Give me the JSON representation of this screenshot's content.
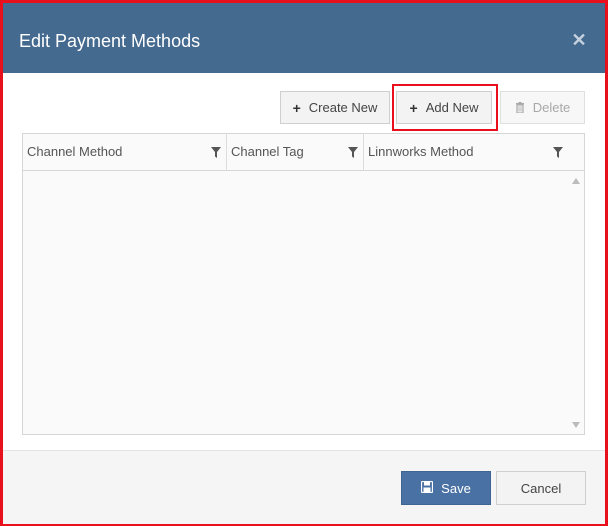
{
  "dialog": {
    "title": "Edit Payment Methods",
    "close_icon": "close-icon"
  },
  "toolbar": {
    "create_new_label": "Create New",
    "add_new_label": "Add New",
    "delete_label": "Delete"
  },
  "grid": {
    "columns": [
      {
        "label": "Channel Method"
      },
      {
        "label": "Channel Tag"
      },
      {
        "label": "Linnworks Method"
      }
    ],
    "rows": []
  },
  "footer": {
    "save_label": "Save",
    "cancel_label": "Cancel"
  },
  "colors": {
    "header_bg": "#456a8f",
    "highlight": "#e8101c",
    "save_bg": "#4a71a3"
  }
}
